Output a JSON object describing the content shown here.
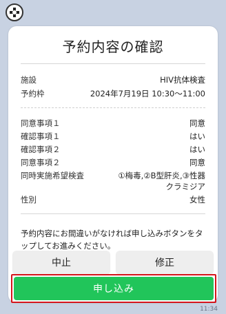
{
  "header": {
    "title": "予約内容の確認"
  },
  "reservation": {
    "facility_label": "施設",
    "facility_value": "HIV抗体検査",
    "slot_label": "予約枠",
    "slot_value": "2024年7月19日 10:30～11:00"
  },
  "answers": [
    {
      "label": "同意事項１",
      "value": "同意"
    },
    {
      "label": "確認事項１",
      "value": "はい"
    },
    {
      "label": "確認事項２",
      "value": "はい"
    },
    {
      "label": "同意事項２",
      "value": "同意"
    },
    {
      "label": "同時実施希望検査",
      "value": "①梅毒,②B型肝炎,③性器クラミジア"
    },
    {
      "label": "性別",
      "value": "女性"
    }
  ],
  "note": "予約内容にお間違いがなければ申し込みボタンをタップしてお進みください。",
  "buttons": {
    "cancel": "中止",
    "edit": "修正",
    "apply": "申し込み"
  },
  "status": {
    "time": "11:34"
  },
  "colors": {
    "apply": "#21c55a",
    "highlight": "#d4141a",
    "background": "#c8d2e2"
  }
}
